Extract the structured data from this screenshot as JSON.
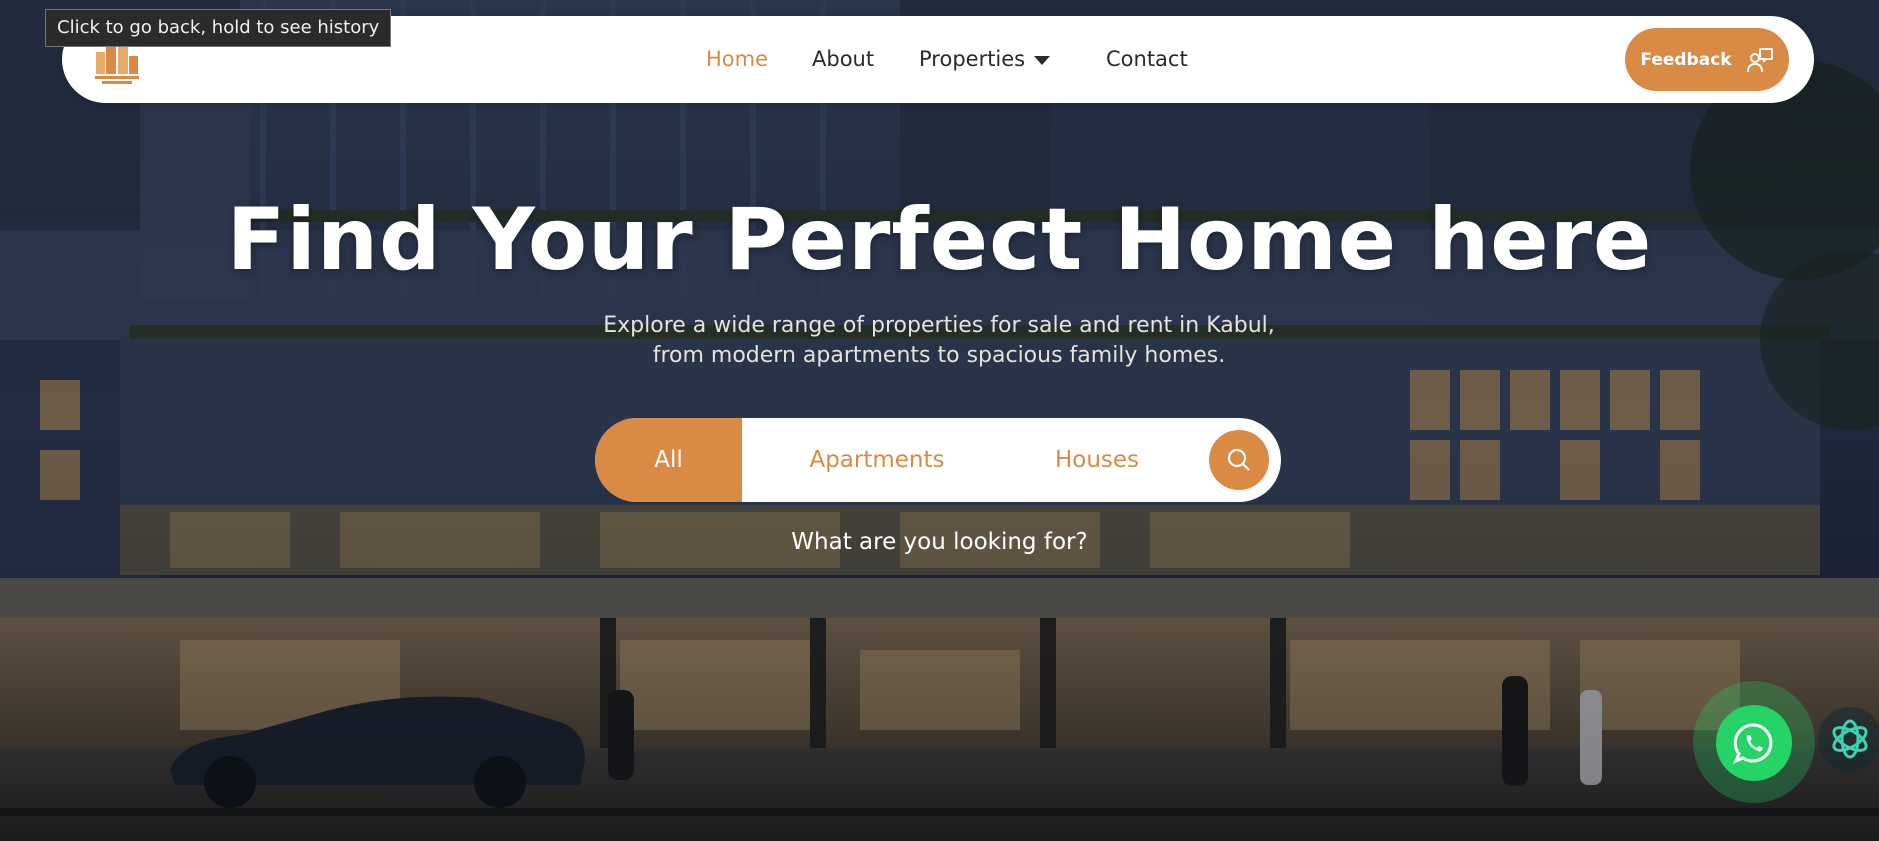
{
  "tooltip": {
    "text": "Click to go back, hold to see history"
  },
  "navbar": {
    "logo_icon": "building-logo-icon",
    "links": {
      "home": "Home",
      "about": "About",
      "properties": "Properties",
      "contact": "Contact"
    },
    "active_link": "Home",
    "feedback_label": "Feedback",
    "feedback_icon": "feedback-person-icon"
  },
  "hero": {
    "title": "Find Your Perfect Home here",
    "subtitle": "Explore a wide range of properties for sale and rent in Kabul, from modern apartments to spacious family homes."
  },
  "search": {
    "tabs": {
      "all": "All",
      "apartments": "Apartments",
      "houses": "Houses"
    },
    "selected_tab": "All",
    "search_icon": "search-icon",
    "prompt": "What are you looking for?"
  },
  "floating": {
    "whatsapp_icon": "whatsapp-icon",
    "assistant_icon": "ai-assistant-icon"
  },
  "colors": {
    "accent": "#d98a45",
    "whatsapp": "#25d366",
    "navbar_bg": "#ffffff"
  }
}
